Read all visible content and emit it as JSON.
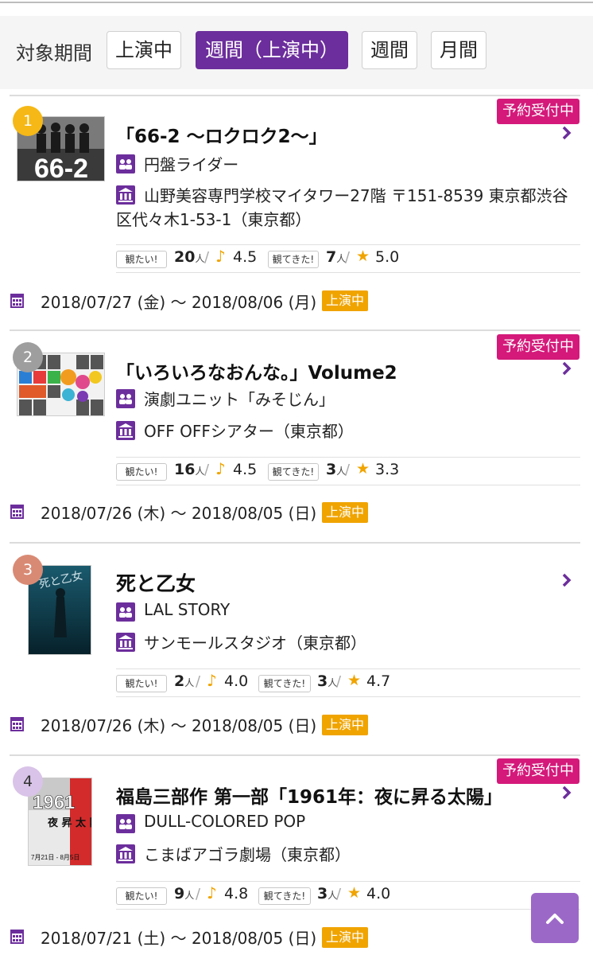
{
  "filter": {
    "label": "対象期間",
    "options": [
      "上演中",
      "週間（上演中）",
      "週間",
      "月間"
    ],
    "selected": "週間（上演中）"
  },
  "labels": {
    "want_tag": "観たい!",
    "seen_tag": "観てきた!",
    "person_unit": "人",
    "reservation": "予約受付中",
    "status": "上演中"
  },
  "colors": {
    "accent": "#6c2e9c",
    "reservation": "#d4197a",
    "status": "#f0a400",
    "rank1": "#f5b816",
    "rank2": "#9e9e9e",
    "rank3": "#d98a74",
    "rank4": "#d9c3e8"
  },
  "events": [
    {
      "rank": "1",
      "title": "「66-2 〜ロクロク2〜」",
      "company": "円盤ライダー",
      "venue_line1": "山野美容専門学校マイタワー27階 〒151-8539 東京都渋谷",
      "venue_line2": "区代々木1-53-1（東京都）",
      "want_count": "20",
      "want_score": "4.5",
      "seen_count": "7",
      "seen_score": "5.0",
      "dates": "2018/07/27 (金) 〜 2018/08/06 (月)",
      "reservation": true,
      "thumb_text": "66-2"
    },
    {
      "rank": "2",
      "title": "「いろいろなおんな。」Volume2",
      "company": "演劇ユニット「みそじん」",
      "venue_line1": "OFF OFFシアター（東京都）",
      "venue_line2": "",
      "want_count": "16",
      "want_score": "4.5",
      "seen_count": "3",
      "seen_score": "3.3",
      "dates": "2018/07/26 (木) 〜 2018/08/05 (日)",
      "reservation": true
    },
    {
      "rank": "3",
      "title": "死と乙女",
      "company": "LAL STORY",
      "venue_line1": "サンモールスタジオ（東京都）",
      "venue_line2": "",
      "want_count": "2",
      "want_score": "4.0",
      "seen_count": "3",
      "seen_score": "4.7",
      "dates": "2018/07/26 (木) 〜 2018/08/05 (日)",
      "reservation": false,
      "thumb_text": "死と乙女"
    },
    {
      "rank": "4",
      "title": "福島三部作 第一部「1961年：夜に昇る太陽」",
      "company": "DULL-COLORED POP",
      "venue_line1": "こまばアゴラ劇場（東京都）",
      "venue_line2": "",
      "want_count": "9",
      "want_score": "4.8",
      "seen_count": "3",
      "seen_score": "4.0",
      "dates": "2018/07/21 (土) 〜 2018/08/05 (日)",
      "reservation": true,
      "thumb_text": "1961",
      "thumb_text2": "夜 昇 太 陽",
      "thumb_text3": "7月21日 - 8月5日"
    }
  ]
}
